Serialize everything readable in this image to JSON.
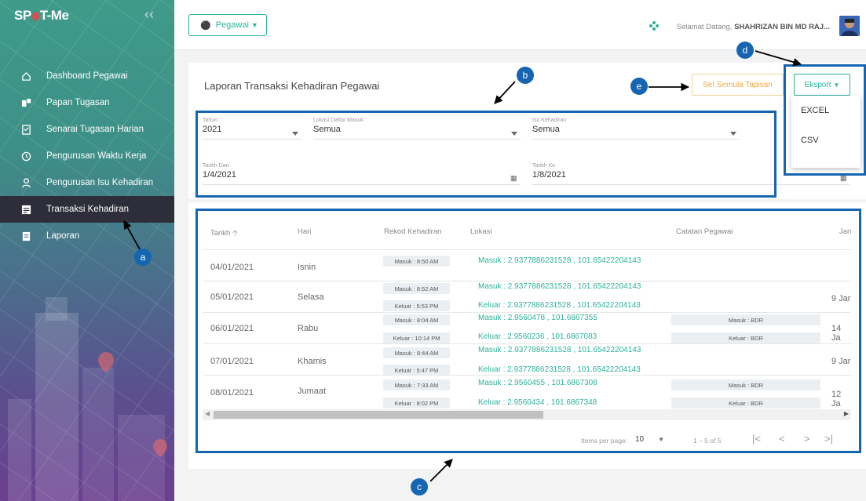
{
  "app": {
    "logo_text_left": "SP",
    "logo_text_right": "T-Me"
  },
  "sidebar": {
    "items": [
      {
        "label": "Dashboard Pegawai",
        "icon": "home-icon"
      },
      {
        "label": "Papan Tugasan",
        "icon": "board-icon"
      },
      {
        "label": "Senarai Tugasan Harian",
        "icon": "checklist-icon"
      },
      {
        "label": "Pengurusan Waktu Kerja",
        "icon": "clock-icon"
      },
      {
        "label": "Pengurusan Isu Kehadiran",
        "icon": "person-icon"
      },
      {
        "label": "Transaksi Kehadiran",
        "icon": "list-icon",
        "active": true
      },
      {
        "label": "Laporan",
        "icon": "report-icon"
      }
    ]
  },
  "topbar": {
    "role_button": "Pegawai",
    "welcome_prefix": "Selamat Datang,",
    "user_name": "SHAHRIZAN BIN MD RAJ..."
  },
  "report": {
    "title": "Laporan Transaksi Kehadiran Pegawai",
    "reset_button": "Set Semula Tapisan",
    "export_button": "Eksport",
    "export_options": [
      "EXCEL",
      "CSV"
    ]
  },
  "filters": {
    "tahun": {
      "label": "Tahun",
      "value": "2021"
    },
    "lokasi": {
      "label": "Lokasi Daftar Masuk",
      "value": "Semua"
    },
    "isu": {
      "label": "Isu Kehadiran",
      "value": "Semua"
    },
    "tarikh_dari": {
      "label": "Tarikh Dari",
      "value": "1/4/2021"
    },
    "tarikh_ke": {
      "label": "Tarikh Ke",
      "value": "1/8/2021"
    }
  },
  "table": {
    "headers": [
      "Tarikh",
      "Hari",
      "Rekod Kehadiran",
      "Lokasi",
      "Catatan Pegawai",
      "Jan"
    ],
    "rows": [
      {
        "date": "04/01/2021",
        "day": "Isnin",
        "in": "Masuk : 8:50 AM",
        "out": "",
        "loc_in": "Masuk : 2.9377886231528 , 101.65422204143",
        "loc_out": "",
        "note_in": "",
        "note_out": "",
        "extra": ""
      },
      {
        "date": "05/01/2021",
        "day": "Selasa",
        "in": "Masuk : 8:52 AM",
        "out": "Keluar : 5:53 PM",
        "loc_in": "Masuk : 2.9377886231528 , 101.65422204143",
        "loc_out": "Keluar : 2.9377886231528 , 101.65422204143",
        "note_in": "",
        "note_out": "",
        "extra": "9 Jar"
      },
      {
        "date": "06/01/2021",
        "day": "Rabu",
        "in": "Masuk : 8:04 AM",
        "out": "Keluar : 10:14 PM",
        "loc_in": "Masuk : 2.9560478 , 101.6867355",
        "loc_out": "Keluar : 2.9560236 , 101.6867083",
        "note_in": "Masuk : BDR",
        "note_out": "Keluar : BDR",
        "extra": "14 Ja"
      },
      {
        "date": "07/01/2021",
        "day": "Khamis",
        "in": "Masuk : 8:44 AM",
        "out": "Keluar : 5:47 PM",
        "loc_in": "Masuk : 2.9377886231528 , 101.65422204143",
        "loc_out": "Keluar : 2.9377886231528 , 101.65422204143",
        "note_in": "",
        "note_out": "",
        "extra": "9 Jar"
      },
      {
        "date": "08/01/2021",
        "day": "Jumaat",
        "in": "Masuk : 7:33 AM",
        "out": "Keluar : 8:02 PM",
        "loc_in": "Masuk : 2.9560455 , 101.6867308",
        "loc_out": "Keluar : 2.9560434 , 101.6867348",
        "note_in": "Masuk : BDR",
        "note_out": "Keluar : BDR",
        "extra": "12 Ja"
      }
    ]
  },
  "pagination": {
    "items_per_page_label": "Items per page:",
    "items_per_page": "10",
    "range": "1 – 5 of 5"
  },
  "annotations": {
    "a": "a",
    "b": "b",
    "c": "c",
    "d": "d",
    "e": "e"
  },
  "colors": {
    "accent": "#2bb39b",
    "annotation": "#1565b0",
    "reset": "#f0a944"
  }
}
